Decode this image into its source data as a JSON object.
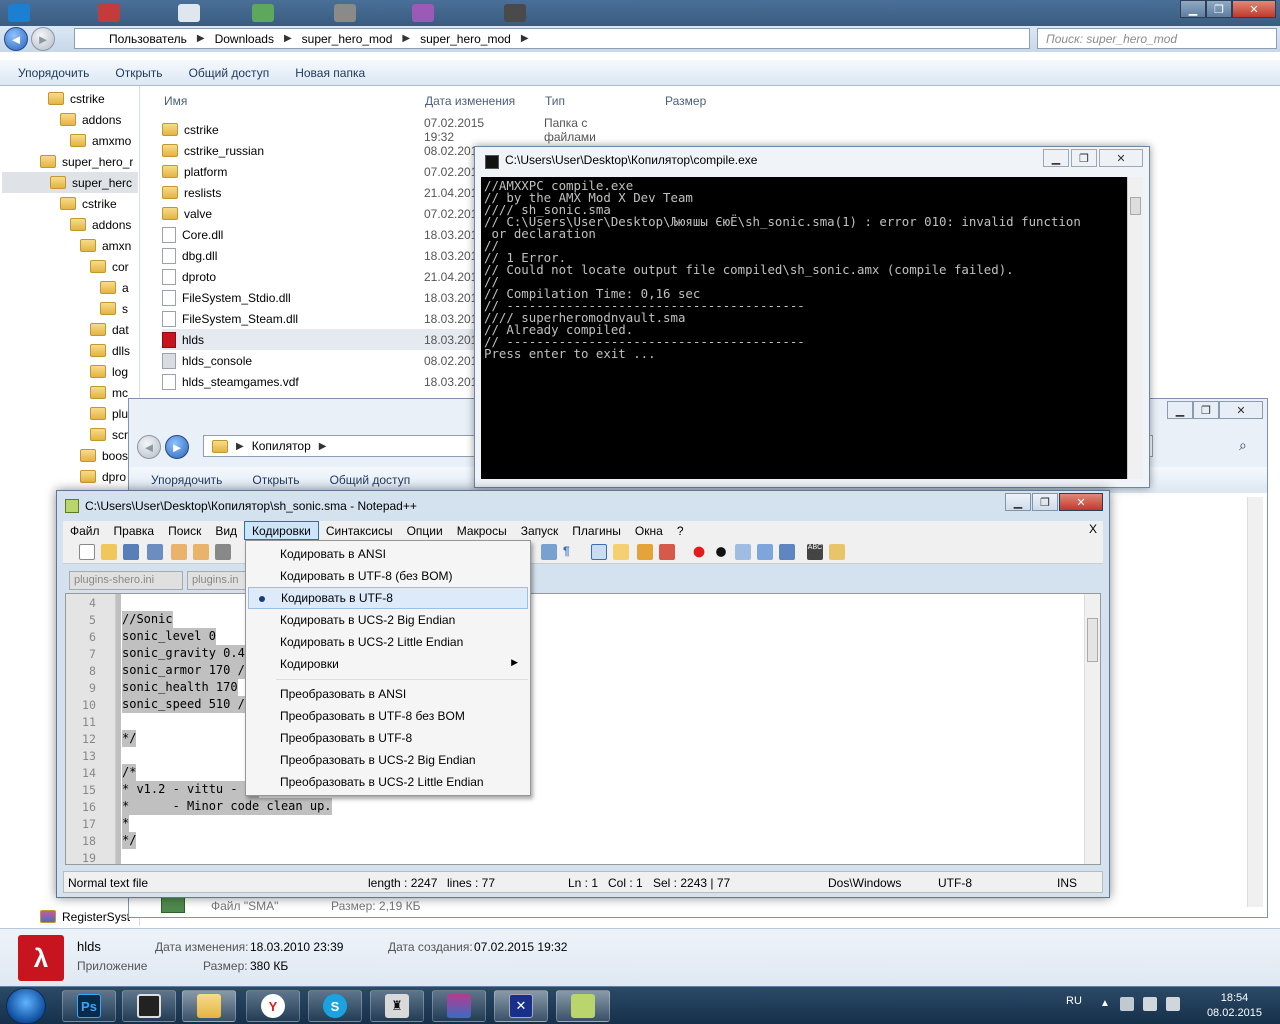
{
  "explorer": {
    "breadcrumbs": [
      "Пользователь",
      "Downloads",
      "super_hero_mod",
      "super_hero_mod"
    ],
    "search_placeholder": "Поиск: super_hero_mod",
    "toolbar": {
      "organize": "Упорядочить",
      "open": "Открыть",
      "share": "Общий доступ",
      "new_folder": "Новая папка"
    },
    "columns": {
      "name": "Имя",
      "date": "Дата изменения",
      "type": "Тип",
      "size": "Размер"
    },
    "nav_items": [
      "cstrike",
      "addons",
      "amxmo",
      "super_hero_r",
      "super_herc",
      "cstrike",
      "addons",
      "amxn",
      "cor",
      "a",
      "s",
      "dat",
      "dlls",
      "log",
      "mc",
      "plu",
      "scr",
      "boos",
      "dpro",
      "RegisterSyst"
    ],
    "files": [
      {
        "name": "cstrike",
        "date": "07.02.2015 19:32",
        "type": "Папка с файлами"
      },
      {
        "name": "cstrike_russian",
        "date": "08.02.201"
      },
      {
        "name": "platform",
        "date": "07.02.201"
      },
      {
        "name": "reslists",
        "date": "21.04.201"
      },
      {
        "name": "valve",
        "date": "07.02.201"
      },
      {
        "name": "Core.dll",
        "date": "18.03.201"
      },
      {
        "name": "dbg.dll",
        "date": "18.03.201"
      },
      {
        "name": "dproto",
        "date": "21.04.201"
      },
      {
        "name": "FileSystem_Stdio.dll",
        "date": "18.03.201"
      },
      {
        "name": "FileSystem_Steam.dll",
        "date": "18.03.201"
      },
      {
        "name": "hlds",
        "date": "18.03.201"
      },
      {
        "name": "hlds_console",
        "date": "08.02.201"
      },
      {
        "name": "hlds_steamgames.vdf",
        "date": "18.03.201"
      }
    ],
    "details": {
      "name": "hlds",
      "kind": "Приложение",
      "modified_label": "Дата изменения:",
      "modified": "18.03.2010 23:39",
      "created_label": "Дата создания:",
      "created": "07.02.2015 19:32",
      "size_label": "Размер:",
      "size": "380 КБ"
    },
    "sma_file": {
      "label": "Файл \"SMA\"",
      "size": "Размер: 2,19 КБ"
    }
  },
  "explorer2": {
    "breadcrumb": "Копилятор",
    "organize": "Упорядочить",
    "open": "Открыть",
    "share": "Общий доступ"
  },
  "console": {
    "title": "C:\\Users\\User\\Desktop\\Копилятор\\compile.exe",
    "lines": [
      "//AMXXPC compile.exe",
      "// by the AMX Mod X Dev Team",
      "",
      "",
      "//// sh_sonic.sma",
      "// C:\\Users\\User\\Desktop\\Љюяшы ЄюЁ\\sh_sonic.sma(1) : error 010: invalid function",
      " or declaration",
      "//",
      "// 1 Error.",
      "// Could not locate output file compiled\\sh_sonic.amx (compile failed).",
      "//",
      "// Compilation Time: 0,16 sec",
      "// ----------------------------------------",
      "",
      "//// superheromodnvault.sma",
      "// Already compiled.",
      "// ----------------------------------------",
      "",
      "Press enter to exit ..."
    ]
  },
  "notepad": {
    "title": "C:\\Users\\User\\Desktop\\Копилятор\\sh_sonic.sma - Notepad++",
    "menu": [
      "Файл",
      "Правка",
      "Поиск",
      "Вид",
      "Кодировки",
      "Синтаксисы",
      "Опции",
      "Макросы",
      "Запуск",
      "Плагины",
      "Окна",
      "?"
    ],
    "close_x": "X",
    "tabs": [
      "plugins-shero.ini",
      "plugins.in"
    ],
    "line_numbers": [
      "4",
      "5",
      "6",
      "7",
      "8",
      "9",
      "10",
      "11",
      "12",
      "13",
      "14",
      "15",
      "16",
      "17",
      "18",
      "19"
    ],
    "code": [
      "",
      "//Sonic",
      "sonic_level 0",
      "sonic_gravity 0.40",
      "sonic_armor 170 //d",
      "sonic_health 170",
      "sonic_speed 510 //h",
      "",
      "*/",
      "",
      "/*",
      "* v1.2 - vittu - 6/",
      "*      - Minor code clean up.",
      "*",
      "*/",
      ""
    ],
    "status": {
      "type": "Normal text file",
      "length": "length : 2247",
      "lines": "lines : 77",
      "ln": "Ln : 1",
      "col": "Col : 1",
      "sel": "Sel : 2243 | 77",
      "eol": "Dos\\Windows",
      "enc": "UTF-8",
      "mode": "INS"
    }
  },
  "encoding_menu": {
    "items": [
      "Кодировать в ANSI",
      "Кодировать в UTF-8 (без BOM)",
      "Кодировать в UTF-8",
      "Кодировать в UCS-2 Big Endian",
      "Кодировать в UCS-2 Little Endian",
      "Кодировки"
    ],
    "convert": [
      "Преобразовать в ANSI",
      "Преобразовать в UTF-8 без BOM",
      "Преобразовать в UTF-8",
      "Преобразовать в UCS-2 Big Endian",
      "Преобразовать в UCS-2 Little Endian"
    ],
    "selected_index": 2
  },
  "taskbar": {
    "lang": "RU",
    "time": "18:54",
    "date": "08.02.2015",
    "apps": [
      "Ps",
      "S"
    ]
  }
}
